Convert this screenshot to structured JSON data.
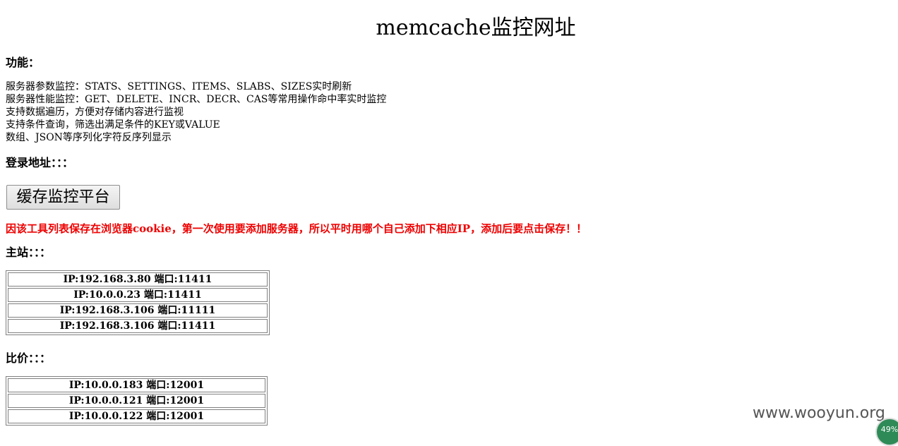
{
  "title": "memcache监控网址",
  "features": {
    "heading": "功能：",
    "items": [
      "服务器参数监控：STATS、SETTINGS、ITEMS、SLABS、SIZES实时刷新",
      "服务器性能监控：GET、DELETE、INCR、DECR、CAS等常用操作命中率实时监控",
      "支持数据遍历，方便对存储内容进行监视",
      "支持条件查询，筛选出满足条件的KEY或VALUE",
      "数组、JSON等序列化字符反序列显示"
    ]
  },
  "login": {
    "heading": "登录地址：：：",
    "button_label": "缓存监控平台"
  },
  "warning": "因该工具列表保存在浏览器cookie，第一次使用要添加服务器，所以平时用哪个自己添加下相应IP，添加后要点击保存！！",
  "main_site": {
    "heading": "主站：：：",
    "servers": [
      "IP:192.168.3.80 端口:11411",
      "IP:10.0.0.23 端口:11411",
      "IP:192.168.3.106 端口:11111",
      "IP:192.168.3.106 端口:11411"
    ]
  },
  "price_compare": {
    "heading": "比价：：：",
    "servers": [
      "IP:10.0.0.183 端口:12001",
      "IP:10.0.0.121 端口:12001",
      "IP:10.0.0.122 端口:12001"
    ]
  },
  "watermark": "www.wooyun.org",
  "badge": "49%"
}
